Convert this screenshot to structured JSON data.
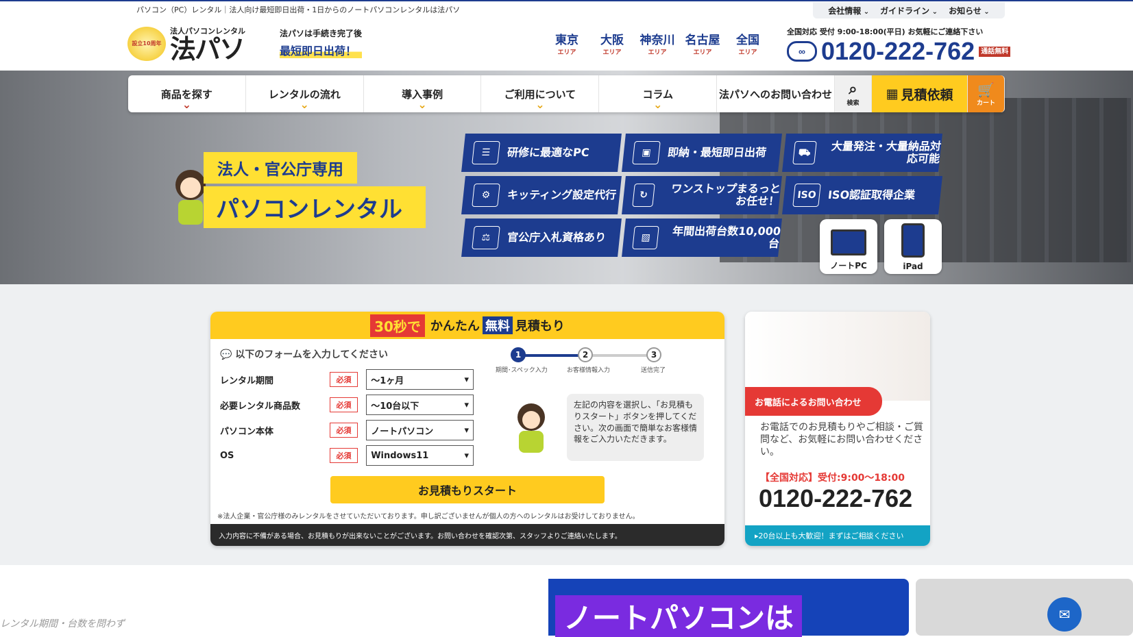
{
  "header": {
    "tagline": "パソコン（PC）レンタル｜法人向け最短即日出荷・1日からのノートパソコンレンタルは法パソ",
    "top_nav": [
      "会社情報",
      "ガイドライン",
      "お知らせ"
    ],
    "logo_badge": "設立10周年",
    "logo_small": "法人パソコンレンタル",
    "logo_big": "法パソ",
    "delivery_small": "法パソは手続き完了後",
    "delivery_big": "最短即日出荷！",
    "areas": [
      {
        "name": "東京",
        "sub": "エリア"
      },
      {
        "name": "大阪",
        "sub": "エリア"
      },
      {
        "name": "神奈川",
        "sub": "エリア"
      },
      {
        "name": "名古屋",
        "sub": "エリア"
      },
      {
        "name": "全国",
        "sub": "エリア"
      }
    ],
    "phone_label": "全国対応 受付 9:00-18:00(平日) お気軽にご連絡下さい",
    "phone_number": "0120-222-762",
    "phone_free": "通話無料",
    "freedial_icon": "freedial-icon"
  },
  "nav": {
    "items": [
      "商品を探す",
      "レンタルの流れ",
      "導入事例",
      "ご利用について",
      "コラム",
      "法パソへのお問い合わせ"
    ],
    "search": "検索",
    "quote": "見積依頼",
    "cart": "カート"
  },
  "hero": {
    "title_small": "法人・官公庁専用",
    "title_big": "パソコンレンタル",
    "features": [
      {
        "label": "研修に最適なPC",
        "icon": "training-icon"
      },
      {
        "label": "即納・最短即日出荷",
        "icon": "delivery-icon"
      },
      {
        "label": "大量発注・大量納品対応可能",
        "icon": "truck-icon"
      },
      {
        "label": "キッティング設定代行",
        "icon": "gear-icon"
      },
      {
        "label": "ワンストップまるっとお任せ！",
        "icon": "cycle-icon"
      },
      {
        "label": "ISO認証取得企業",
        "icon": "iso-icon"
      },
      {
        "label": "官公庁入札資格あり",
        "icon": "gavel-icon"
      },
      {
        "label": "年間出荷台数10,000台",
        "icon": "box-icon"
      }
    ],
    "devices": [
      "ノートPC",
      "iPad"
    ]
  },
  "form": {
    "header_30": "30秒で",
    "header_pre": "かんたん",
    "header_free": "無料",
    "header_post": "見積もり",
    "intro": "以下のフォームを入力してください",
    "required": "必須",
    "rows": [
      {
        "label": "レンタル期間",
        "value": "〜1ヶ月"
      },
      {
        "label": "必要レンタル商品数",
        "value": "〜10台以下"
      },
      {
        "label": "パソコン本体",
        "value": "ノートパソコン"
      },
      {
        "label": "OS",
        "value": "Windows11"
      }
    ],
    "steps": [
      {
        "num": "1",
        "label": "期間･スペック入力"
      },
      {
        "num": "2",
        "label": "お客様情報入力"
      },
      {
        "num": "3",
        "label": "送信完了"
      }
    ],
    "bubble": "左記の内容を選択し、「お見積もりスタート」ボタンを押してください。次の画面で簡単なお客様情報をご入力いただきます。",
    "start": "お見積もりスタート",
    "note1": "※法人企業・官公庁様のみレンタルをさせていただいております。申し訳ございませんが個人の方へのレンタルはお受けしておりません。",
    "note2": "入力内容に不備がある場合、お見積もりが出来ないことがございます。お問い合わせを確認次第、スタッフよりご連絡いたします。"
  },
  "call": {
    "tag": "お電話によるお問い合わせ",
    "text": "お電話でのお見積もりやご相談・ご質問など、お気軽にお問い合わせください。",
    "hours": "【全国対応】受付:9:00〜18:00",
    "number": "0120-222-762",
    "bar": "20台以上も大歓迎！まずはご相談ください"
  },
  "bottom": {
    "card1": "レンタル期間・台数を問わず",
    "card2": "ノートパソコンは"
  }
}
